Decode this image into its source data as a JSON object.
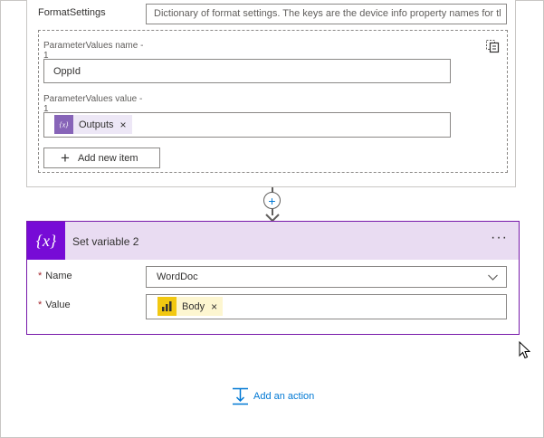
{
  "colors": {
    "variable_purple": "#770bd6",
    "header_tint": "#e9dcf2",
    "powerbi_yellow": "#f2c811",
    "link_blue": "#0078d4",
    "required_red": "#a4262c"
  },
  "previous_action": {
    "format_settings_label": "FormatSettings",
    "format_settings_placeholder": "Dictionary of format settings. The keys are the device info property names for tl",
    "parameter_items": [
      {
        "name_label": "ParameterValues name -\n1",
        "name_value": "OppId",
        "value_label": "ParameterValues value -\n1",
        "value_token": {
          "label": "Outputs",
          "icon": "variable-icon"
        }
      }
    ],
    "add_item_label": "Add new item",
    "copy_icon": "copy-icon"
  },
  "insert_step_icon": "plus-icon",
  "set_variable": {
    "title": "Set variable 2",
    "icon_text": "{x}",
    "menu_label": "···",
    "name_field": {
      "label": "Name",
      "required_mark": "*",
      "value": "WordDoc"
    },
    "value_field": {
      "label": "Value",
      "required_mark": "*",
      "token": {
        "label": "Body",
        "icon": "powerbi-icon"
      }
    },
    "token_close": "×"
  },
  "add_action_label": "Add an action"
}
